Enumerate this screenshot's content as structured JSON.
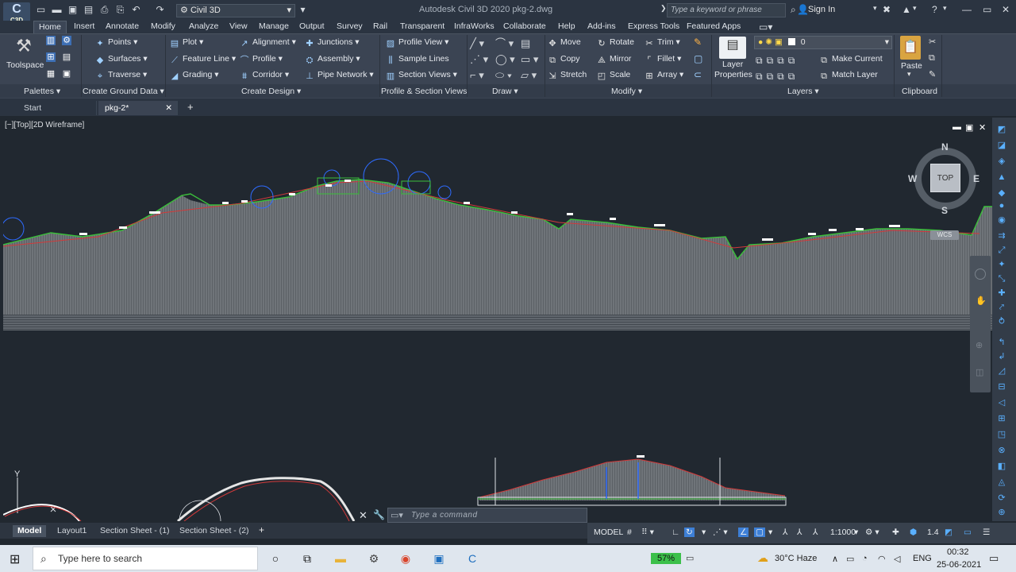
{
  "titlebar": {
    "app_badge": "C",
    "app_badge_sub": "C3D",
    "workspace": "Civil 3D",
    "title": "Autodesk Civil 3D 2020    pkg-2.dwg",
    "search_placeholder": "Type a keyword or phrase",
    "sign_in": "Sign In"
  },
  "menu_tabs": [
    "Home",
    "Insert",
    "Annotate",
    "Modify",
    "Analyze",
    "View",
    "Manage",
    "Output",
    "Survey",
    "Rail",
    "Transparent",
    "InfraWorks",
    "Collaborate",
    "Help",
    "Add-ins",
    "Express Tools",
    "Featured Apps"
  ],
  "ribbon": {
    "toolspace": "Toolspace",
    "ground": {
      "points": "Points",
      "surfaces": "Surfaces",
      "traverse": "Traverse"
    },
    "design": {
      "plot": "Plot",
      "feature_line": "Feature Line",
      "grading": "Grading",
      "alignment": "Alignment",
      "profile": "Profile",
      "corridor": "Corridor",
      "junctions": "Junctions",
      "assembly": "Assembly",
      "pipe_network": "Pipe Network"
    },
    "profile_section": {
      "profile_view": "Profile View",
      "sample_lines": "Sample Lines",
      "section_views": "Section Views"
    },
    "modify": {
      "move": "Move",
      "copy": "Copy",
      "stretch": "Stretch",
      "rotate": "Rotate",
      "mirror": "Mirror",
      "scale": "Scale",
      "trim": "Trim",
      "fillet": "Fillet",
      "array": "Array"
    },
    "layers": {
      "layer_properties_1": "Layer",
      "layer_properties_2": "Properties",
      "current_layer": "0",
      "make_current": "Make Current",
      "match_layer": "Match Layer"
    },
    "clipboard": {
      "paste": "Paste"
    },
    "panels": {
      "palettes": "Palettes",
      "create_ground": "Create Ground Data",
      "create_design": "Create Design",
      "profile_section": "Profile & Section Views",
      "draw": "Draw",
      "modify": "Modify",
      "layers": "Layers",
      "clipboard": "Clipboard"
    }
  },
  "doc_tabs": {
    "start": "Start",
    "file": "pkg-2*"
  },
  "viewport": {
    "label": "[−][Top][2D Wireframe]"
  },
  "viewcube": {
    "n": "N",
    "s": "S",
    "e": "E",
    "w": "W",
    "top": "TOP",
    "wcs": "WCS"
  },
  "ucs": {
    "y": "Y"
  },
  "layout_tabs": [
    "Model",
    "Layout1",
    "Section Sheet - (1)",
    "Section Sheet - (2)"
  ],
  "command": {
    "placeholder": "Type a command"
  },
  "status": {
    "model": "MODEL",
    "scale": "1:1000",
    "annoscale": "1.4"
  },
  "taskbar": {
    "search": "Type here to search",
    "battery": "57%",
    "weather": "30°C  Haze",
    "lang": "ENG",
    "time": "00:32",
    "date": "25-06-2021"
  },
  "colors": {
    "surface": "#3bbf3b",
    "profile": "#d23a3a",
    "hatch": "#9aa0a6",
    "accent": "#2e8bff"
  }
}
